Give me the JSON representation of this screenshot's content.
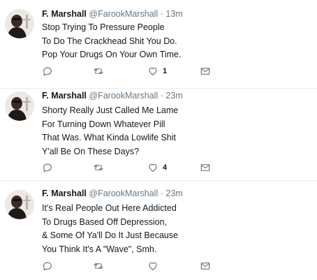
{
  "tweets": [
    {
      "name": "F. Marshall",
      "handle": "@FarookMarshall",
      "separator": "·",
      "time": "13m",
      "lines": [
        "Stop Trying To Pressure People",
        "To Do The Crackhead Shit You Do.",
        "Pop Your Drugs On Your Own Time."
      ],
      "like_count": "1"
    },
    {
      "name": "F. Marshall",
      "handle": "@FarookMarshall",
      "separator": "·",
      "time": "23m",
      "lines": [
        "Shorty Really Just Called Me Lame",
        "For Turning Down Whatever Pill",
        "That Was. What Kinda Lowlife Shit",
        "Y'all Be On These Days?"
      ],
      "like_count": "4"
    },
    {
      "name": "F. Marshall",
      "handle": "@FarookMarshall",
      "separator": "·",
      "time": "23m",
      "lines": [
        "It's Real People Out Here Addicted",
        "To Drugs Based Off Depression,",
        "& Some Of Ya'll Do It Just Because",
        "You Think It's A \"Wave\", Smh."
      ],
      "like_count": ""
    }
  ],
  "icons": {
    "reply": "reply-icon",
    "retweet": "retweet-icon",
    "like": "heart-icon",
    "message": "envelope-icon"
  },
  "colors": {
    "text": "#14171a",
    "muted": "#657786",
    "divider": "#e6ecf0"
  }
}
